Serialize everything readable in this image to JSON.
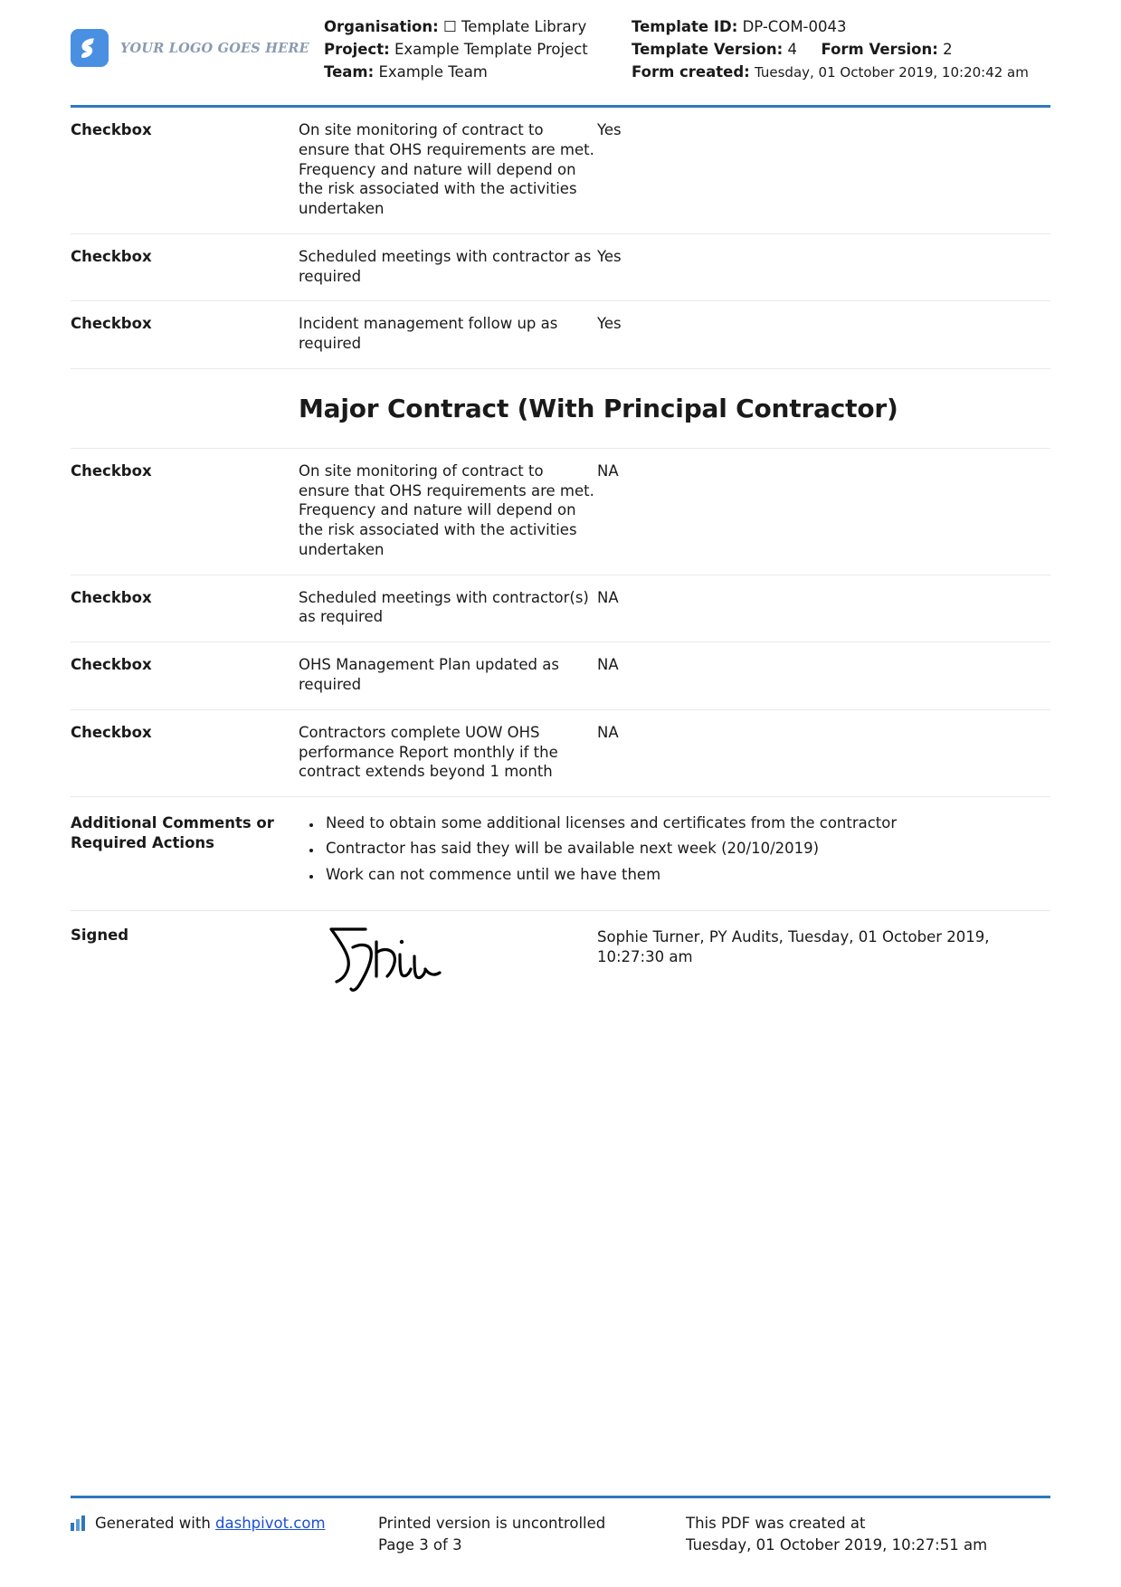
{
  "header": {
    "logo_text": "YOUR LOGO GOES HERE",
    "logo_color": "#4a90e2",
    "left": {
      "organisation_label": "Organisation:",
      "organisation_value": "☐ Template Library",
      "project_label": "Project:",
      "project_value": "Example Template Project",
      "team_label": "Team:",
      "team_value": "Example Team"
    },
    "right": {
      "template_id_label": "Template ID:",
      "template_id_value": "DP-COM-0043",
      "template_version_label": "Template Version:",
      "template_version_value": "4",
      "form_version_label": "Form Version:",
      "form_version_value": "2",
      "form_created_label": "Form created:",
      "form_created_value": "Tuesday, 01 October 2019, 10:20:42 am"
    }
  },
  "rows_top": [
    {
      "label": "Checkbox",
      "description": "On site monitoring of contract to ensure that OHS requirements are met. Frequency and nature will depend on the risk associated with the activities undertaken",
      "value": "Yes"
    },
    {
      "label": "Checkbox",
      "description": "Scheduled meetings with contractor as required",
      "value": "Yes"
    },
    {
      "label": "Checkbox",
      "description": "Incident management follow up as required",
      "value": "Yes"
    }
  ],
  "section": {
    "title": "Major Contract (With Principal Contractor)"
  },
  "rows_major": [
    {
      "label": "Checkbox",
      "description": "On site monitoring of contract to ensure that OHS requirements are met. Frequency and nature will depend on the risk associated with the activities undertaken",
      "value": "NA"
    },
    {
      "label": "Checkbox",
      "description": "Scheduled meetings with contractor(s) as required",
      "value": "NA"
    },
    {
      "label": "Checkbox",
      "description": "OHS Management Plan updated as required",
      "value": "NA"
    },
    {
      "label": "Checkbox",
      "description": "Contractors complete UOW OHS performance Report monthly if the contract extends beyond 1 month",
      "value": "NA"
    }
  ],
  "comments": {
    "label_line1": "Additional Comments or",
    "label_line2": "Required Actions",
    "items": [
      "Need to obtain some additional licenses and certificates from the contractor",
      "Contractor has said they will be available next week (20/10/2019)",
      "Work can not commence until we have them"
    ]
  },
  "signed": {
    "label": "Signed",
    "signature_text": "Sophie",
    "details": "Sophie Turner, PY Audits, Tuesday, 01 October 2019, 10:27:30 am"
  },
  "footer": {
    "generated_prefix": "Generated with ",
    "generated_link": "dashpivot.com",
    "printed_line1": "Printed version is uncontrolled",
    "printed_line2": "Page 3 of 3",
    "created_line1": "This PDF was created at",
    "created_line2": "Tuesday, 01 October 2019, 10:27:51 am",
    "accent_color": "#2f77bb"
  }
}
